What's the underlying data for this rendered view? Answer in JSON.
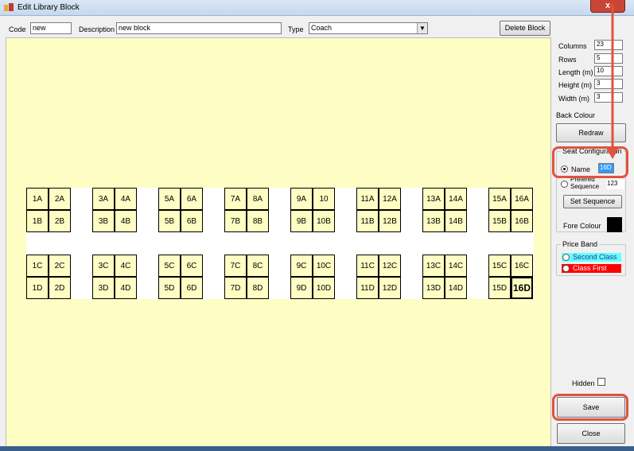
{
  "window": {
    "title": "Edit Library Block",
    "close_glyph": "x"
  },
  "top": {
    "code_label": "Code",
    "code_value": "new",
    "desc_label": "Description",
    "desc_value": "new block",
    "type_label": "Type",
    "type_value": "Coach",
    "delete_label": "Delete Block"
  },
  "canvas_color": "#fefdc3",
  "seats": {
    "top_row1": [
      "1A",
      "2A",
      "3A",
      "4A",
      "5A",
      "6A",
      "7A",
      "8A",
      "9A",
      "10",
      "11A",
      "12A",
      "13A",
      "14A",
      "15A",
      "16A"
    ],
    "top_row2": [
      "1B",
      "2B",
      "3B",
      "4B",
      "5B",
      "6B",
      "7B",
      "8B",
      "9B",
      "10B",
      "11B",
      "12B",
      "13B",
      "14B",
      "15B",
      "16B"
    ],
    "bot_row1": [
      "1C",
      "2C",
      "3C",
      "4C",
      "5C",
      "6C",
      "7C",
      "8C",
      "9C",
      "10C",
      "11C",
      "12C",
      "13C",
      "14C",
      "15C",
      "16C"
    ],
    "bot_row2": [
      "1D",
      "2D",
      "3D",
      "4D",
      "5D",
      "6D",
      "7D",
      "8D",
      "9D",
      "10D",
      "11D",
      "12D",
      "13D",
      "14D",
      "15D",
      "16D"
    ],
    "selected": "16D"
  },
  "side": {
    "columns_label": "Columns",
    "columns_value": "23",
    "rows_label": "Rows",
    "rows_value": "5",
    "length_label": "Length (m)",
    "length_value": "10",
    "height_label": "Height (m)",
    "height_value": "3",
    "width_label": "Width (m)",
    "width_value": "3",
    "back_colour_label": "Back Colour",
    "redraw_label": "Redraw",
    "seat_config_title": "Seat Configuration",
    "name_label": "Name",
    "name_value": "16D",
    "pref_seq_label1": "Prefered",
    "pref_seq_label2": "Sequence",
    "pref_seq_value": "123",
    "set_sequence_label": "Set Sequence",
    "fore_colour_label": "Fore Colour",
    "price_band_title": "Price Band",
    "second_class_label": "Second Class",
    "first_class_label": "Class First",
    "hidden_label": "Hidden",
    "save_label": "Save",
    "close_label": "Close"
  },
  "colors": {
    "second_class": "#66ffff",
    "first_class": "#ff0000",
    "highlight": "#e0533e",
    "fore_colour": "#000000"
  }
}
